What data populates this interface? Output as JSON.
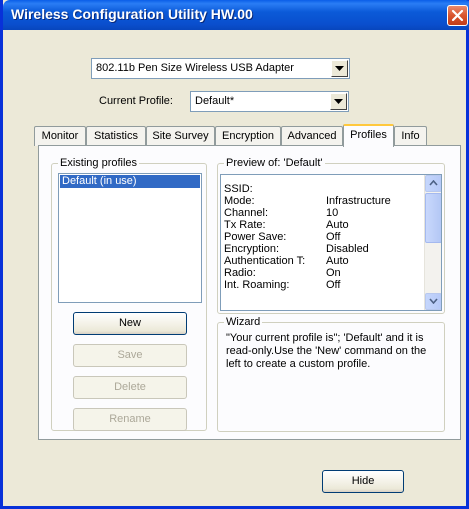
{
  "window": {
    "title": "Wireless Configuration Utility HW.00"
  },
  "adapter_select": {
    "value": "802.11b Pen Size Wireless USB Adapter"
  },
  "profile_select": {
    "label": "Current Profile:",
    "value": "Default*"
  },
  "tabs": [
    {
      "label": "Monitor"
    },
    {
      "label": "Statistics"
    },
    {
      "label": "Site Survey"
    },
    {
      "label": "Encryption"
    },
    {
      "label": "Advanced"
    },
    {
      "label": "Profiles",
      "active": true
    },
    {
      "label": "Info"
    }
  ],
  "existing_profiles": {
    "title": "Existing profiles",
    "items": [
      "Default (in use)"
    ]
  },
  "buttons": {
    "new": "New",
    "save": "Save",
    "delete": "Delete",
    "rename": "Rename",
    "hide": "Hide"
  },
  "preview": {
    "title": "Preview of: 'Default'",
    "rows": [
      {
        "key": "SSID:",
        "value": ""
      },
      {
        "key": "Mode:",
        "value": "Infrastructure"
      },
      {
        "key": "Channel:",
        "value": "10"
      },
      {
        "key": "Tx Rate:",
        "value": "Auto"
      },
      {
        "key": "Power Save:",
        "value": "Off"
      },
      {
        "key": "Encryption:",
        "value": "Disabled"
      },
      {
        "key": "Authentication T:",
        "value": "Auto"
      },
      {
        "key": "Radio:",
        "value": "On"
      },
      {
        "key": "Int. Roaming:",
        "value": "Off"
      }
    ]
  },
  "wizard": {
    "title": "Wizard",
    "lines": [
      "\"Your current profile is\"; 'Default' and it is",
      "read-only.Use the 'New' command on the",
      "left to create a custom profile."
    ]
  },
  "icons": {
    "close": "close-icon",
    "dropdown": "chevron-down-icon",
    "scroll_up": "arrow-up-icon",
    "scroll_down": "arrow-down-icon"
  },
  "colors": {
    "titlebar": "#0a5ee8",
    "selection": "#316ac5",
    "close": "#d9552e",
    "active_tab_accent": "#ffc83c"
  }
}
